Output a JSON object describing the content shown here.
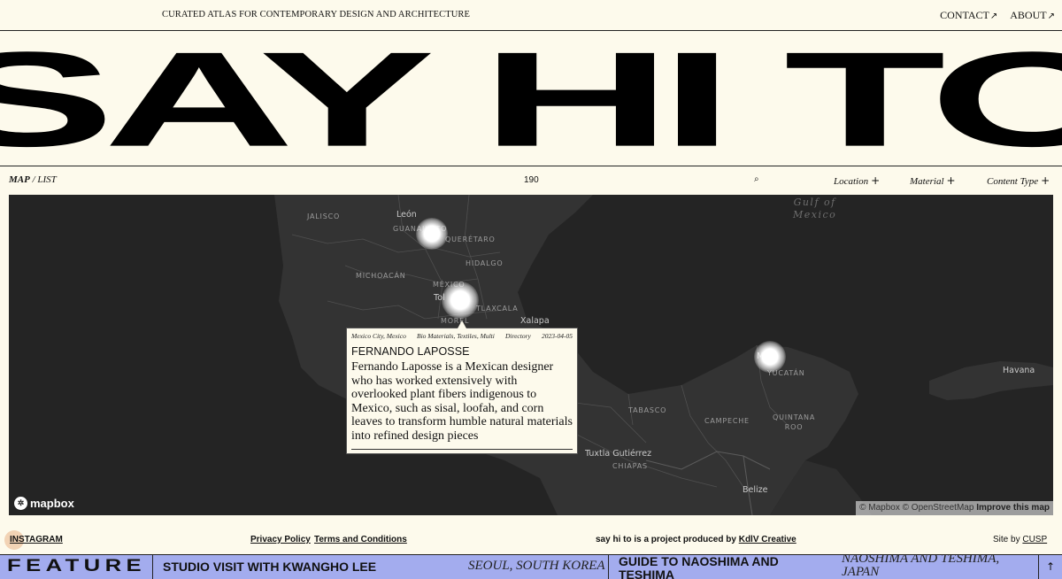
{
  "header": {
    "tagline": "CURATED ATLAS FOR CONTEMPORARY DESIGN AND ARCHITECTURE",
    "nav": [
      {
        "label": "CONTACT",
        "arrow": "↗"
      },
      {
        "label": "ABOUT",
        "arrow": "↗"
      }
    ]
  },
  "hero": {
    "title": "SAY HI TO"
  },
  "filters": {
    "view_map": "MAP",
    "view_sep": "/",
    "view_list": "LIST",
    "count": "190",
    "search_icon": "⌕",
    "location": "Location",
    "material": "Material",
    "content_type": "Content Type",
    "plus": "+"
  },
  "map": {
    "labels": {
      "jalisco": "JALISCO",
      "leon": "León",
      "guanajuato": "GUANAJUATO",
      "queretaro": "QUERÉTARO",
      "hidalgo": "HIDALGO",
      "michoacan": "MICHOACÁN",
      "mexico": "MÉXICO",
      "toluca": "Tol",
      "tlaxcala": "TLAXCALA",
      "morelos": "MOREL",
      "xalapa": "Xalapa",
      "gulf": "Gulf of\nMexico",
      "merida": "Mé",
      "yucatan": "YUCATÁN",
      "havana": "Havana",
      "tabasco": "TABASCO",
      "campeche": "CAMPECHE",
      "quintana": "QUINTANA\nROO",
      "tuxtla": "Tuxtla Gutiérrez",
      "chiapas": "CHIAPAS",
      "belize": "Belize"
    },
    "popup": {
      "location": "Mexico City, Mexico",
      "materials": "Bio Materials, Textiles, Multi",
      "category": "Directory",
      "date": "2023-04-05",
      "title": "FERNANDO LAPOSSE",
      "description": "Fernando Laposse is a Mexican designer who has worked extensively with overlooked plant fibers indigenous to Mexico, such as sisal, loofah, and corn leaves to transform humble natural materials into refined design pieces"
    },
    "logo": "mapbox",
    "attribution": {
      "mapbox": "© Mapbox",
      "osm": "© OpenStreetMap",
      "improve": "Improve this map"
    }
  },
  "footer": {
    "instagram": "INSTAGRAM",
    "privacy": "Privacy Policy",
    "terms": "Terms and Conditions",
    "project_text": "say hi to is a project produced by",
    "producer": "KdlV Creative",
    "site_by": "Site by",
    "site_by_name": "CUSP"
  },
  "ticker": {
    "label": "FEATURE",
    "items": [
      {
        "title": "STUDIO VISIT WITH KWANGHO LEE",
        "location": "SEOUL, SOUTH KOREA"
      },
      {
        "title": "GUIDE TO NAOSHIMA AND TESHIMA",
        "location": "NAOSHIMA AND TESHIMA, JAPAN"
      }
    ],
    "up_arrow": "↑"
  },
  "colors": {
    "background": "#fdfaec",
    "map": "#242424",
    "ticker": "#a3acee",
    "ink": "#111111"
  }
}
